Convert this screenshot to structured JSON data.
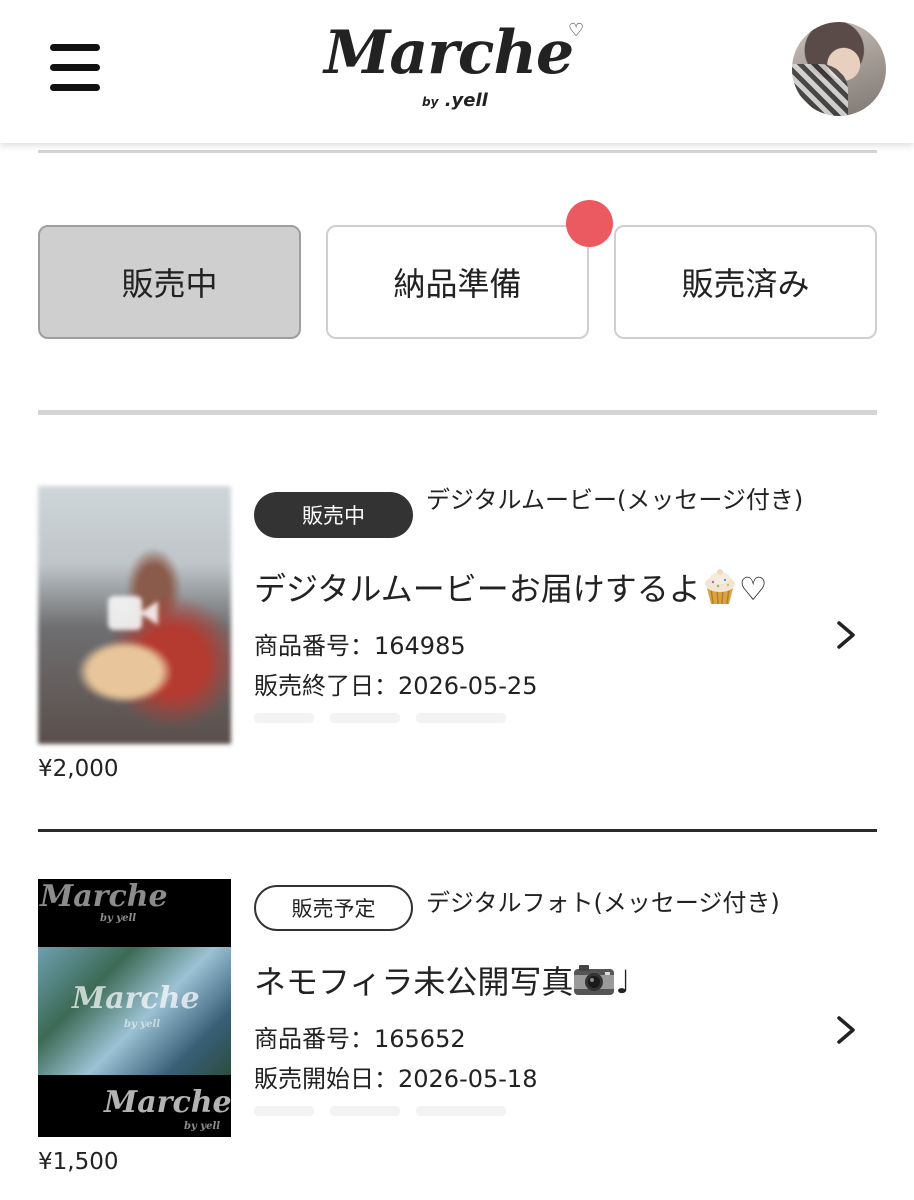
{
  "header": {
    "logo_text": "Marche",
    "logo_sub_by": "by",
    "logo_sub_brand": ".yell"
  },
  "tabs": [
    {
      "label": "販売中",
      "active": true
    },
    {
      "label": "納品準備",
      "active": false,
      "has_notification": true
    },
    {
      "label": "販売済み",
      "active": false
    }
  ],
  "items": [
    {
      "status": "販売中",
      "category": "デジタルムービー(メッセージ付き)",
      "title": "デジタルムービーお届けするよ",
      "title_suffix": "♡",
      "product_no": "商品番号：164985",
      "date": "販売終了日：2026-05-25",
      "price": "¥2,000",
      "media_icon": "video-icon"
    },
    {
      "status": "販売予定",
      "category": "デジタルフォト(メッセージ付き)",
      "title": "ネモフィラ未公開写真",
      "title_suffix": "♩",
      "product_no": "商品番号：165652",
      "date": "販売開始日：2026-05-18",
      "price": "¥1,500",
      "watermark": "Marche",
      "watermark_sub": "by yell"
    }
  ],
  "colors": {
    "notification": "#ea5a60",
    "active_tab": "#cfcfcf",
    "badge_dark": "#333333"
  }
}
